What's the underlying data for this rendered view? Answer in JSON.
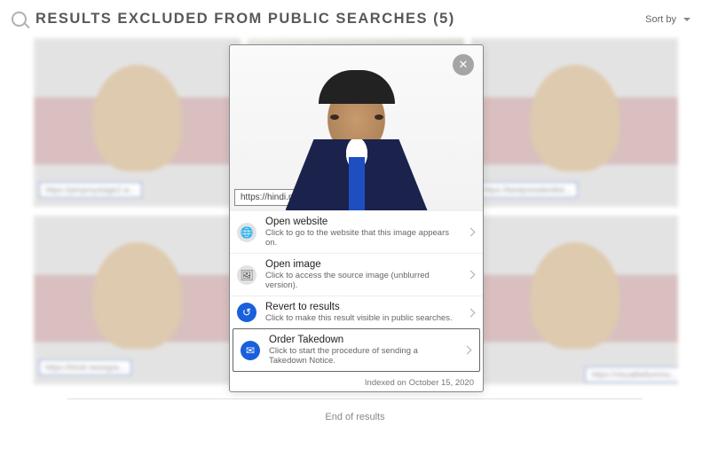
{
  "header": {
    "title": "RESULTS EXCLUDED FROM PUBLIC SEARCHES (5)",
    "sort_label": "Sort by"
  },
  "grid": {
    "rows": [
      {
        "items": [
          {
            "url_chip": "https://pimpmystage2.w..."
          },
          {
            "url_chip": ""
          },
          {
            "url_chip": "https://bestpresidentlist..."
          }
        ]
      },
      {
        "items": [
          {
            "url_chip": "https://hindi.newsgra..."
          },
          {
            "url_chip": ""
          },
          {
            "url_chip": "https://visualbeliummu..."
          }
        ]
      }
    ],
    "end_label": "End of results"
  },
  "modal": {
    "url": "https://hindi.newsgra...",
    "actions": [
      {
        "icon": "globe-icon",
        "icon_glyph": "🌐",
        "style": "gray",
        "title": "Open website",
        "desc": "Click to go to the website that this image appears on."
      },
      {
        "icon": "image-icon",
        "icon_glyph": "🖼",
        "style": "gray",
        "title": "Open image",
        "desc": "Click to access the source image (unblurred version)."
      },
      {
        "icon": "undo-icon",
        "icon_glyph": "↺",
        "style": "blue",
        "title": "Revert to results",
        "desc": "Click to make this result visible in public searches."
      },
      {
        "icon": "stamp-icon",
        "icon_glyph": "✉",
        "style": "blue",
        "title": "Order Takedown",
        "desc": "Click to start the procedure of sending a Takedown Notice.",
        "highlight": true
      }
    ],
    "indexed": "Indexed on October 15, 2020"
  }
}
